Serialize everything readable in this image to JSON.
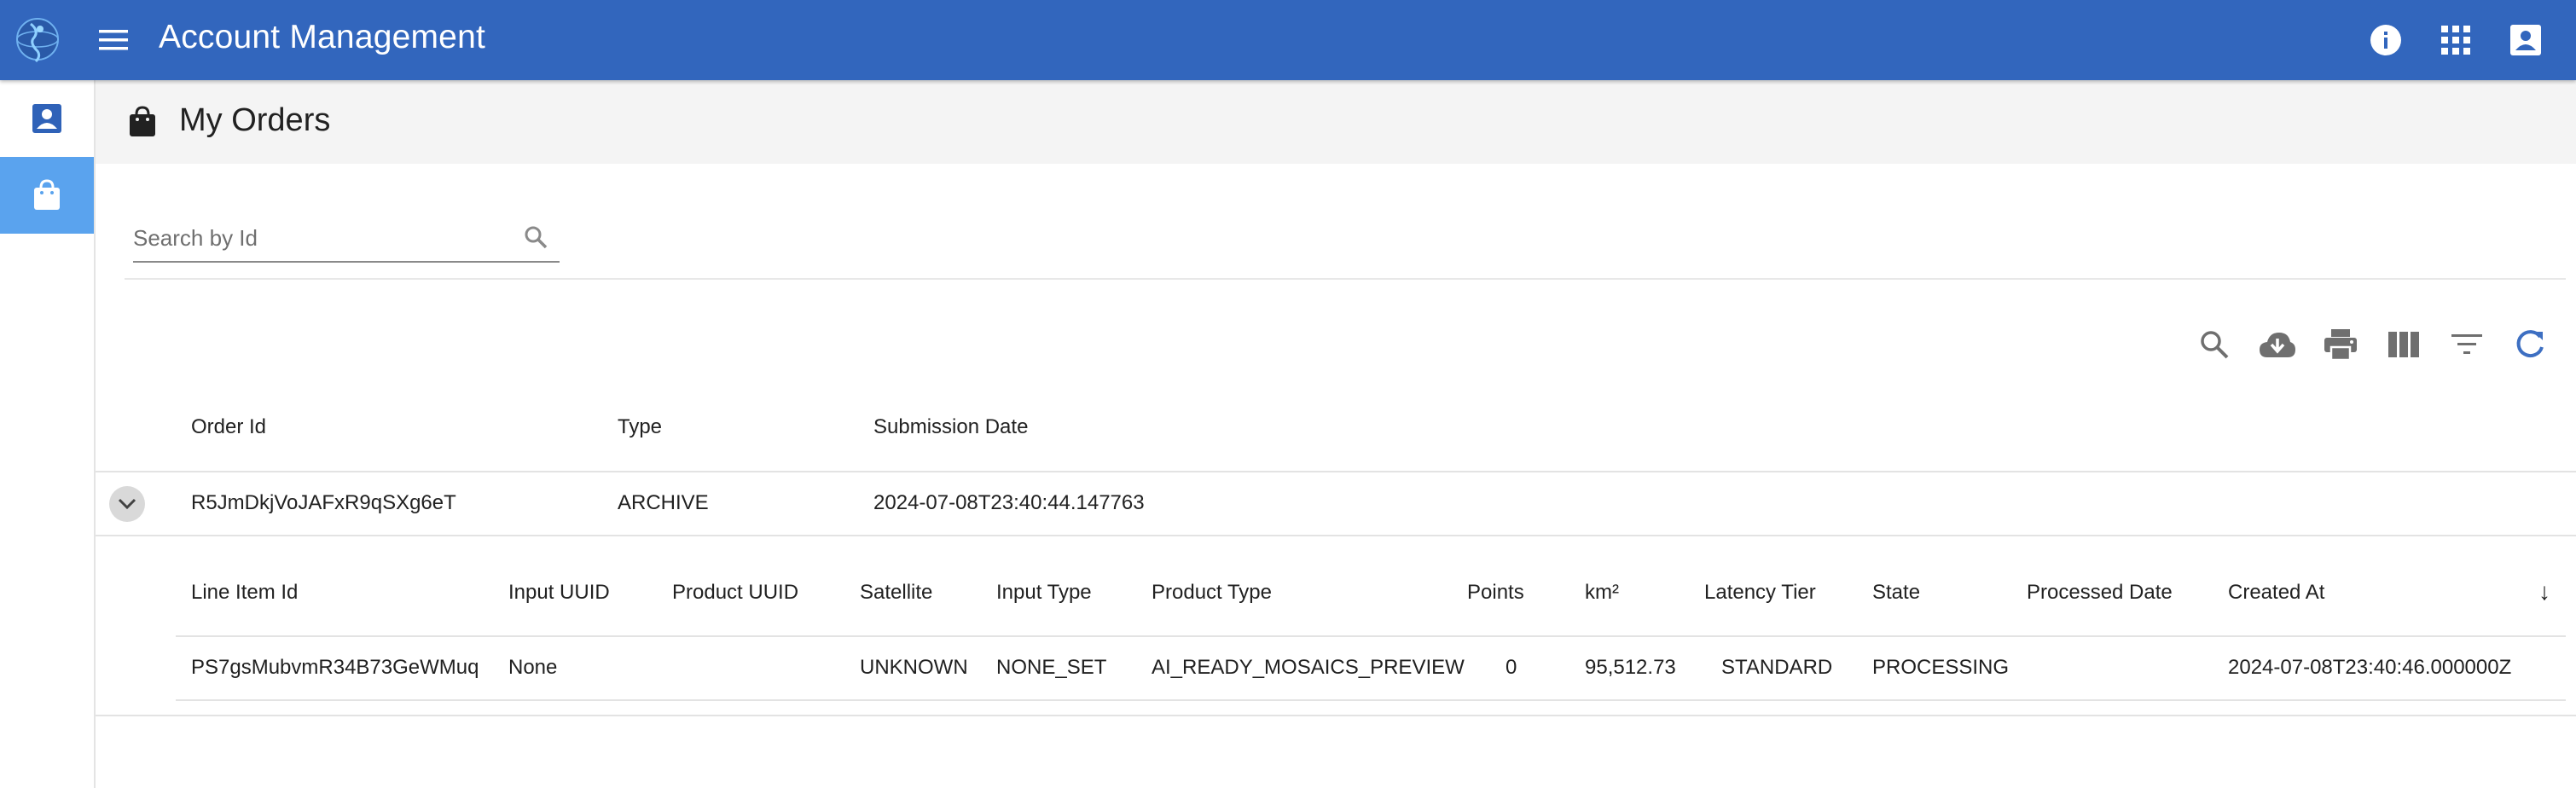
{
  "app": {
    "title": "Account Management"
  },
  "icons": {
    "logo": "globe-logo-icon",
    "menu": "menu-icon",
    "info": "info-icon",
    "apps": "apps-grid-icon",
    "account": "account-box-icon",
    "orders": "shopping-bag-icon"
  },
  "colors": {
    "topbar": "#3266bd",
    "sidebar_active": "#5aa3ee",
    "refresh_icon": "#3d6fc2"
  },
  "page": {
    "title": "My Orders"
  },
  "search": {
    "placeholder": "Search by Id",
    "value": ""
  },
  "toolbar": {
    "icons": [
      "search-icon",
      "cloud-download-icon",
      "print-icon",
      "view-column-icon",
      "filter-list-icon",
      "refresh-icon"
    ]
  },
  "orders_table": {
    "headers": [
      "Order Id",
      "Type",
      "Submission Date"
    ],
    "rows": [
      {
        "order_id": "R5JmDkjVoJAFxR9qSXg6eT",
        "type": "ARCHIVE",
        "submission_date": "2024-07-08T23:40:44.147763"
      }
    ]
  },
  "line_items_table": {
    "headers": [
      "Line Item Id",
      "Input UUID",
      "Product UUID",
      "Satellite",
      "Input Type",
      "Product Type",
      "Points",
      "km²",
      "Latency Tier",
      "State",
      "Processed Date",
      "Created At"
    ],
    "sort_indicator": "↓",
    "rows": [
      {
        "line_item_id": "PS7gsMubvmR34B73GeWMuq",
        "input_uuid": "None",
        "product_uuid": "",
        "satellite": "UNKNOWN",
        "input_type": "NONE_SET",
        "product_type": "AI_READY_MOSAICS_PREVIEW",
        "points": "0",
        "km2": "95,512.73",
        "latency_tier": "STANDARD",
        "state": "PROCESSING",
        "processed_date": "",
        "created_at": "2024-07-08T23:40:46.000000Z"
      }
    ]
  }
}
